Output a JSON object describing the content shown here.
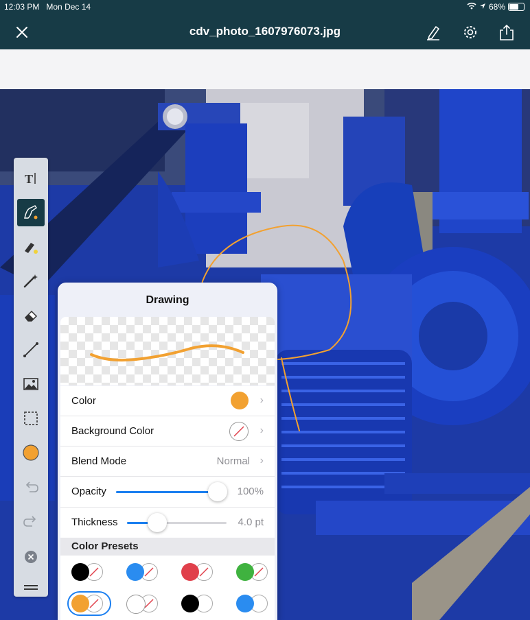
{
  "status_bar": {
    "time": "12:03 PM",
    "date": "Mon Dec 14",
    "battery": "68%"
  },
  "nav": {
    "title": "cdv_photo_1607976073.jpg",
    "close_icon": "close-icon",
    "pen_icon": "pen-icon",
    "settings_icon": "gear-icon",
    "share_icon": "share-icon"
  },
  "toolbar": {
    "tools": [
      "text-tool-icon",
      "freehand-draw-icon",
      "highlighter-icon",
      "magic-pen-icon",
      "eraser-icon",
      "line-icon",
      "image-icon",
      "selection-icon",
      "color-icon",
      "undo-icon",
      "redo-icon",
      "clear-icon",
      "toolbar-handle-icon"
    ],
    "current_color": "#f2a131"
  },
  "drawing_panel": {
    "title": "Drawing",
    "preview_stroke_color": "#f2a131",
    "color": {
      "label": "Color",
      "value": "#f2a131"
    },
    "background_color": {
      "label": "Background Color",
      "value": "none"
    },
    "blend_mode": {
      "label": "Blend Mode",
      "value": "Normal"
    },
    "opacity": {
      "label": "Opacity",
      "value": "100%",
      "fraction": 1.0
    },
    "thickness": {
      "label": "Thickness",
      "value": "4.0 pt",
      "fraction": 0.3
    },
    "presets_header": "Color Presets",
    "presets": [
      {
        "color": "#000000",
        "background": "none",
        "selected": false
      },
      {
        "color": "#2a8cf0",
        "background": "none",
        "selected": false
      },
      {
        "color": "#e0404b",
        "background": "none",
        "selected": false
      },
      {
        "color": "#3fb23f",
        "background": "none",
        "selected": false
      },
      {
        "color": "#f2a131",
        "background": "none",
        "selected": true
      },
      {
        "color": "#ffffff",
        "background": "none",
        "selected": false
      },
      {
        "color": "#000000",
        "background": "#ffffff",
        "selected": false
      },
      {
        "color": "#2a8cf0",
        "background": "#ffffff",
        "selected": false
      }
    ]
  },
  "colors": {
    "nav_bar": "#173b46",
    "accent": "#1b7ff0",
    "annotation": "#f2a131"
  }
}
